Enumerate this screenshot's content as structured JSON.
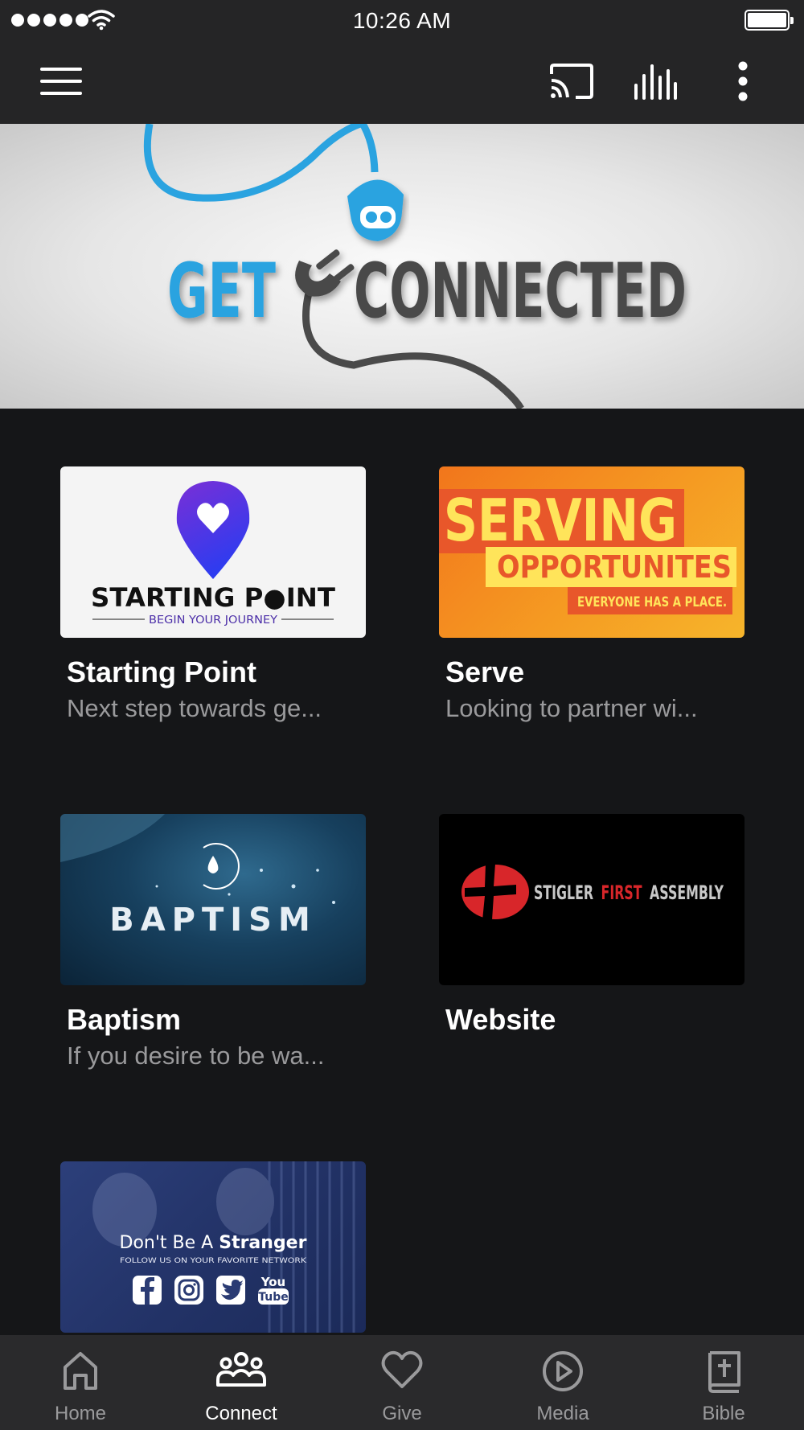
{
  "status_bar": {
    "time": "10:26 AM",
    "icons": [
      "signal-dots-icon",
      "wifi-icon",
      "battery-icon"
    ]
  },
  "app_bar": {
    "icons": [
      "menu-icon",
      "cast-icon",
      "equalizer-icon",
      "more-vertical-icon"
    ]
  },
  "banner": {
    "text_left": "GET",
    "text_right": "CONNECTED",
    "colors": {
      "blue": "#2aa3e0",
      "gray": "#4a4a4a"
    }
  },
  "cards": [
    {
      "title": "Starting Point",
      "subtitle": "Next step towards ge...",
      "image": {
        "logo_text": "STARTING P●INT",
        "tagline": "BEGIN YOUR JOURNEY"
      }
    },
    {
      "title": "Serve",
      "subtitle": "Looking to partner wi...",
      "image": {
        "line1": "SERVING",
        "line2": "OPPORTUNITES",
        "line3": "EVERYONE HAS A PLACE."
      }
    },
    {
      "title": "Baptism",
      "subtitle": "If you desire to be wa...",
      "image": {
        "text": "BAPTISM"
      }
    },
    {
      "title": "Website",
      "subtitle": "",
      "image": {
        "text_stigler": "STIGLER",
        "text_first": "FIRST",
        "text_assembly": "ASSEMBLY"
      }
    },
    {
      "title": "",
      "subtitle": "",
      "image": {
        "headline_a": "Don't Be A ",
        "headline_b": "Stranger",
        "tagline": "FOLLOW US ON YOUR FAVORITE NETWORK",
        "yt_you": "You",
        "yt_tube": "Tube"
      }
    }
  ],
  "bottom_nav": {
    "active": "Connect",
    "items": [
      {
        "label": "Home",
        "icon": "home-icon"
      },
      {
        "label": "Connect",
        "icon": "people-icon"
      },
      {
        "label": "Give",
        "icon": "heart-icon"
      },
      {
        "label": "Media",
        "icon": "play-circle-icon"
      },
      {
        "label": "Bible",
        "icon": "bible-icon"
      }
    ]
  },
  "colors": {
    "background": "#151618",
    "bar": "#252526",
    "nav": "#2a2a2c",
    "subtitle": "#9a9a9c"
  }
}
